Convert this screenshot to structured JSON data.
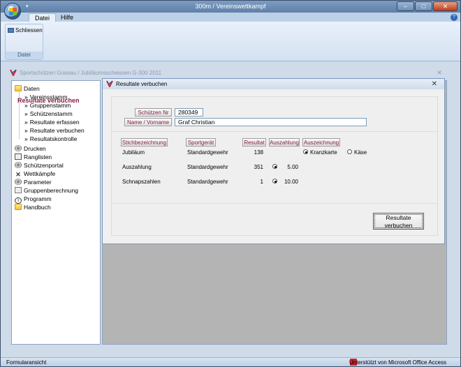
{
  "window": {
    "title": "300m / Vereinswettkampf"
  },
  "tabs": [
    {
      "label": "Datei"
    },
    {
      "label": "Hilfe"
    }
  ],
  "ribbon": {
    "button_label": "Schliessen",
    "group_label": "Datei"
  },
  "appbar": {
    "text": "Sportschützen Gossau  /  Jubiläumsschiessen G-300 2011"
  },
  "nav": {
    "items": [
      {
        "label": "Daten"
      },
      {
        "label": "Vereinsstamm"
      },
      {
        "label": "Gruppenstamm"
      },
      {
        "label": "Schützenstamm"
      },
      {
        "label": "Resultate erfassen"
      },
      {
        "label": "Resultate verbuchen"
      },
      {
        "label": "Resultatskontrolle"
      },
      {
        "label": "Drucken"
      },
      {
        "label": "Ranglisten"
      },
      {
        "label": "Schützenportal"
      },
      {
        "label": "Wettkämpfe"
      },
      {
        "label": "Parameter"
      },
      {
        "label": "Gruppenberechnung"
      },
      {
        "label": "Programm"
      },
      {
        "label": "Handbuch"
      }
    ]
  },
  "form": {
    "title": "Resultate verbuchen",
    "header": "Resultate verbuchen",
    "schuetzen_nr_label": "Schützen Nr",
    "schuetzen_nr_value": "280349",
    "name_label": "Name / Vorname",
    "name_value": "Graf Christian",
    "columns": {
      "stich": "Stichbezeichnung",
      "sportgeraet": "Sportgerät",
      "resultat": "Resultat",
      "auszahlung": "Auszahlung",
      "auszeichnung": "Auszeichnung"
    },
    "rows": [
      {
        "stich": "Jubiläum",
        "sportgeraet": "Standardgewehr",
        "resultat": "138",
        "auszahlung": "",
        "kranzkarte": "Kranzkarte",
        "kaese": "Käse"
      },
      {
        "stich": "Auszahlung",
        "sportgeraet": "Standardgewehr",
        "resultat": "351",
        "auszahlung": "5.00"
      },
      {
        "stich": "Schnapszahlen",
        "sportgeraet": "Standardgewehr",
        "resultat": "1",
        "auszahlung": "10.00"
      }
    ],
    "submit_line1": "Resultate",
    "submit_line2": "verbuchen"
  },
  "status": {
    "left": "Formularansicht",
    "right": "Unterstützt von Microsoft Office Access"
  }
}
